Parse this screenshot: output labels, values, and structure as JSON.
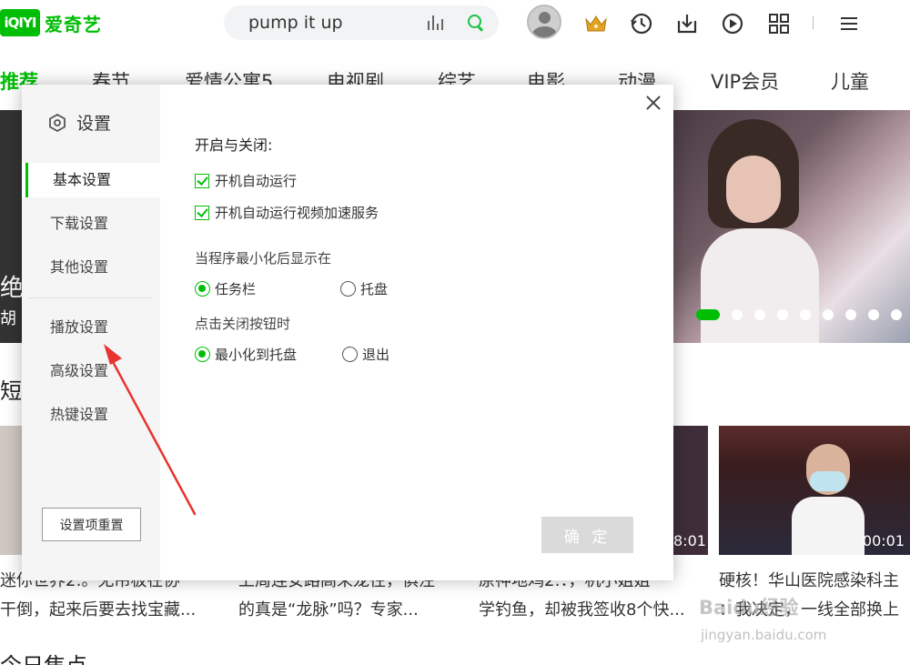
{
  "app": {
    "logo_mark": "iQIYI",
    "logo_text": "爱奇艺",
    "brand_color": "#00be06"
  },
  "search": {
    "value": "pump it up"
  },
  "toolbar": {
    "icons": [
      "avatar-icon",
      "vip-crown-icon",
      "history-icon",
      "download-icon",
      "play-icon",
      "grid-icon",
      "menu-icon"
    ]
  },
  "nav": {
    "items": [
      "推荐",
      "春节",
      "爱情公寓5",
      "电视剧",
      "综艺",
      "电影",
      "动漫",
      "VIP会员",
      "儿童"
    ],
    "active_index": 0
  },
  "banner": {
    "left_title": "绝",
    "left_subtitle": "胡",
    "slides": 10,
    "active_slide": 0
  },
  "sections": {
    "short_video_title": "短",
    "today_title": "今日焦点"
  },
  "videos": [
    {
      "line1": "迷你世界2:。无吊板在协",
      "line2": "干倒，起来后要去找宝藏..."
    },
    {
      "line1": "上周连安路高来龙往，俱注",
      "line2": "的真是“龙脉”吗？专家..."
    },
    {
      "line1": "原神地鸡2:：，机小姐姐",
      "line2": "学钓鱼，却被我签收8个快..."
    },
    {
      "line1": "硬核！华山医院感染科主",
      "line2": "：我决定，一线全部换上",
      "time": "00:01"
    }
  ],
  "thumb_b_time": "8:01",
  "dialog": {
    "title": "设置",
    "sidebar": [
      {
        "label": "基本设置",
        "active": true
      },
      {
        "label": "下载设置",
        "active": false
      },
      {
        "label": "其他设置",
        "active": false
      },
      {
        "label": "播放设置",
        "active": false
      },
      {
        "label": "高级设置",
        "active": false
      },
      {
        "label": "热键设置",
        "active": false
      }
    ],
    "reset_label": "设置项重置",
    "heading": "开启与关闭:",
    "checkboxes": [
      {
        "label": "开机自动运行",
        "checked": true
      },
      {
        "label": "开机自动运行视频加速服务",
        "checked": true
      }
    ],
    "minimize_group": {
      "label": "当程序最小化后显示在",
      "options": [
        {
          "label": "任务栏",
          "selected": true
        },
        {
          "label": "托盘",
          "selected": false
        }
      ]
    },
    "close_group": {
      "label": "点击关闭按钮时",
      "options": [
        {
          "label": "最小化到托盘",
          "selected": true
        },
        {
          "label": "退出",
          "selected": false
        }
      ]
    },
    "ok_label": "确 定"
  },
  "watermark": {
    "main": "Baidu经验",
    "sub": "jingyan.baidu.com"
  }
}
